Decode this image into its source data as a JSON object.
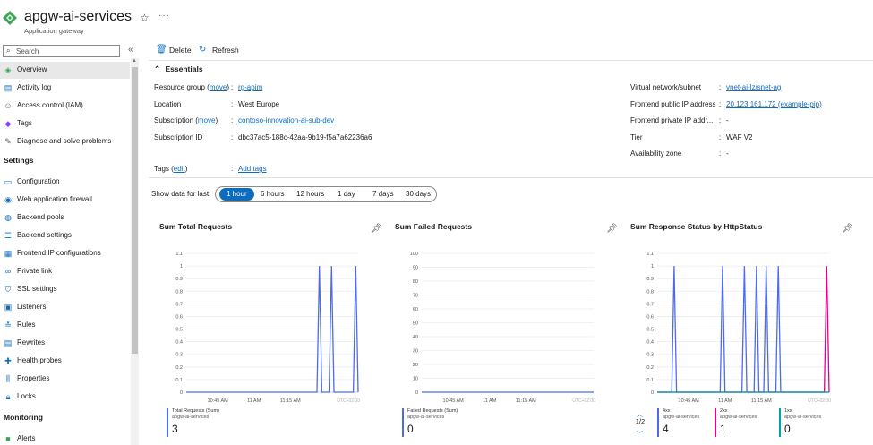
{
  "header": {
    "title": "apgw-ai-services",
    "subtitle": "Application gateway",
    "star_icon": "star-icon",
    "more": "···"
  },
  "sidebar": {
    "search_placeholder": "Search",
    "collapse": "«",
    "items": [
      {
        "label": "Overview",
        "icon": "overview-icon",
        "glyph": "◈",
        "color": "#3aa655"
      },
      {
        "label": "Activity log",
        "icon": "activity-log-icon",
        "glyph": "▤",
        "color": "#0f6cbd"
      },
      {
        "label": "Access control (IAM)",
        "icon": "iam-icon",
        "glyph": "☺",
        "color": "#555"
      },
      {
        "label": "Tags",
        "icon": "tag-icon",
        "glyph": "◆",
        "color": "#8a3ffc"
      },
      {
        "label": "Diagnose and solve problems",
        "icon": "wrench-icon",
        "glyph": "✎",
        "color": "#555"
      }
    ],
    "settings_heading": "Settings",
    "settings_items": [
      {
        "label": "Configuration",
        "icon": "configuration-icon",
        "glyph": "▭",
        "color": "#0f6cbd"
      },
      {
        "label": "Web application firewall",
        "icon": "firewall-icon",
        "glyph": "◉",
        "color": "#0f6cbd"
      },
      {
        "label": "Backend pools",
        "icon": "backend-pools-icon",
        "glyph": "◍",
        "color": "#0f6cbd"
      },
      {
        "label": "Backend settings",
        "icon": "backend-settings-icon",
        "glyph": "☰",
        "color": "#0f6cbd"
      },
      {
        "label": "Frontend IP configurations",
        "icon": "frontend-ip-icon",
        "glyph": "▦",
        "color": "#0f6cbd"
      },
      {
        "label": "Private link",
        "icon": "private-link-icon",
        "glyph": "∞",
        "color": "#0f6cbd"
      },
      {
        "label": "SSL settings",
        "icon": "ssl-shield-icon",
        "glyph": "⛉",
        "color": "#0f6cbd"
      },
      {
        "label": "Listeners",
        "icon": "listeners-icon",
        "glyph": "▣",
        "color": "#0f6cbd"
      },
      {
        "label": "Rules",
        "icon": "rules-icon",
        "glyph": "≛",
        "color": "#0f6cbd"
      },
      {
        "label": "Rewrites",
        "icon": "rewrites-icon",
        "glyph": "▤",
        "color": "#0f6cbd"
      },
      {
        "label": "Health probes",
        "icon": "health-probes-icon",
        "glyph": "✚",
        "color": "#0f6cbd"
      },
      {
        "label": "Properties",
        "icon": "properties-icon",
        "glyph": "⫼",
        "color": "#0f6cbd"
      },
      {
        "label": "Locks",
        "icon": "lock-icon",
        "glyph": "🔒︎",
        "color": "#0f6cbd"
      }
    ],
    "monitoring_heading": "Monitoring",
    "monitoring_items": [
      {
        "label": "Alerts",
        "icon": "alerts-icon",
        "glyph": "■",
        "color": "#3aa655"
      }
    ]
  },
  "toolbar": {
    "delete_label": "Delete",
    "refresh_label": "Refresh"
  },
  "essentials": {
    "heading": "Essentials",
    "left": [
      {
        "label": "Resource group",
        "move": "move",
        "value": "rg-apim",
        "link": true
      },
      {
        "label": "Location",
        "value": "West Europe",
        "link": false
      },
      {
        "label": "Subscription",
        "move": "move",
        "value": "contoso-innovation-ai-sub-dev",
        "link": true
      },
      {
        "label": "Subscription ID",
        "value": "dbc37ac5-188c-42aa-9b19-f5a7a62236a6",
        "link": false
      }
    ],
    "right": [
      {
        "label": "Virtual network/subnet",
        "value": "vnet-ai-lz/snet-ag",
        "link": true
      },
      {
        "label": "Frontend public IP address",
        "value": "20.123.161.172 (example-pip)",
        "link": true
      },
      {
        "label": "Frontend private IP addr...",
        "value": "-",
        "link": false
      },
      {
        "label": "Tier",
        "value": "WAF V2",
        "link": false
      },
      {
        "label": "Availability zone",
        "value": "-",
        "link": false
      }
    ],
    "tags_label": "Tags",
    "tags_edit": "edit",
    "tags_value": "Add tags"
  },
  "time_filter": {
    "label": "Show data for last",
    "options": [
      "1 hour",
      "6 hours",
      "12 hours",
      "1 day",
      "7 days",
      "30 days"
    ],
    "selected": "1 hour"
  },
  "timezone_label": "UTC+02:00",
  "chart_data": [
    {
      "type": "line",
      "title": "Sum Total Requests",
      "x_ticks": [
        "10:45 AM",
        "11 AM",
        "11:15 AM"
      ],
      "y_ticks": [
        "0",
        "0.1",
        "0.2",
        "0.3",
        "0.4",
        "0.5",
        "0.6",
        "0.7",
        "0.8",
        "0.9",
        "1",
        "1.1"
      ],
      "ylim": [
        0,
        1.1
      ],
      "x": [
        "10:32",
        "11:25",
        "11:26",
        "11:27",
        "11:28",
        "11:29",
        "11:31",
        "11:32",
        "11:33",
        "11:34",
        "11:35",
        "11:36",
        "11:41",
        "11:42",
        "11:43"
      ],
      "series": [
        {
          "name": "Total Requests (Sum)",
          "resource": "apgw-ai-services",
          "total": "3",
          "color": "#4f6bed",
          "values": [
            0,
            0,
            0,
            1,
            0,
            0,
            0,
            1,
            0,
            0,
            0,
            0,
            0,
            1,
            0
          ]
        }
      ]
    },
    {
      "type": "line",
      "title": "Sum Failed Requests",
      "x_ticks": [
        "10:45 AM",
        "11 AM",
        "11:15 AM"
      ],
      "y_ticks": [
        "0",
        "10",
        "20",
        "30",
        "40",
        "50",
        "60",
        "70",
        "80",
        "90",
        "100"
      ],
      "ylim": [
        0,
        100
      ],
      "x": [
        "10:32",
        "11:43"
      ],
      "series": [
        {
          "name": "Failed Requests (Sum)",
          "resource": "apgw-ai-services",
          "total": "0",
          "color": "#4f6bed",
          "values": [
            0,
            0
          ]
        }
      ]
    },
    {
      "type": "line",
      "title": "Sum Response Status by HttpStatus",
      "x_ticks": [
        "10:45 AM",
        "11 AM",
        "11:15 AM"
      ],
      "y_ticks": [
        "0",
        "0.1",
        "0.2",
        "0.3",
        "0.4",
        "0.5",
        "0.6",
        "0.7",
        "0.8",
        "0.9",
        "1",
        "1.1"
      ],
      "ylim": [
        0,
        1.1
      ],
      "x": [
        "10:32",
        "10:38",
        "10:39",
        "10:40",
        "10:58",
        "10:59",
        "11:00",
        "11:07",
        "11:08",
        "11:09",
        "11:12",
        "11:13",
        "11:14",
        "11:16",
        "11:17",
        "11:18",
        "11:21",
        "11:22",
        "11:23",
        "11:41",
        "11:42",
        "11:43"
      ],
      "series": [
        {
          "name": "4xx",
          "resource": "apgw-ai-services",
          "total": "4",
          "color": "#4f6bed",
          "values": [
            0,
            0,
            1,
            0,
            0,
            1,
            0,
            0,
            1,
            0,
            0,
            1,
            0,
            0,
            1,
            0,
            0,
            1,
            0,
            0,
            0,
            0
          ]
        },
        {
          "name": "2xx",
          "resource": "apgw-ai-services",
          "total": "1",
          "color": "#e3008c",
          "values": [
            0,
            0,
            0,
            0,
            0,
            0,
            0,
            0,
            0,
            0,
            0,
            0,
            0,
            0,
            0,
            0,
            0,
            0,
            0,
            0,
            1,
            0
          ]
        },
        {
          "name": "1xx",
          "resource": "apgw-ai-services",
          "total": "0",
          "color": "#00a2ad",
          "values": [
            0,
            0,
            0,
            0,
            0,
            0,
            0,
            0,
            0,
            0,
            0,
            0,
            0,
            0,
            0,
            0,
            0,
            0,
            0,
            0,
            0,
            0
          ]
        }
      ]
    }
  ],
  "pager": {
    "label": "1/2"
  }
}
